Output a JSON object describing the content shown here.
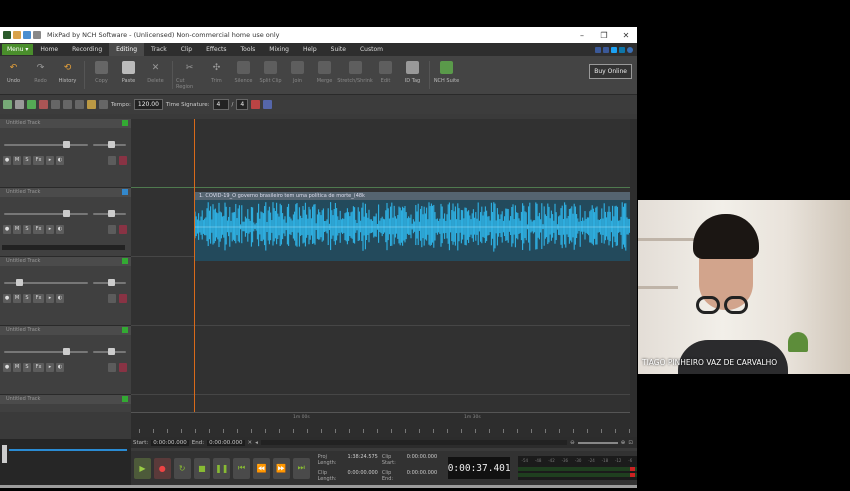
{
  "window": {
    "title": "MixPad by NCH Software - (Unlicensed) Non-commercial home use only",
    "controls": [
      "–",
      "❐",
      "✕"
    ]
  },
  "menubar": {
    "menu_label": "Menu ▾",
    "items": [
      "Home",
      "Recording",
      "Editing",
      "Track",
      "Clip",
      "Effects",
      "Tools",
      "Mixing",
      "Help",
      "Suite",
      "Custom"
    ],
    "active": "Editing"
  },
  "toolbar": {
    "buttons": [
      {
        "label": "Undo",
        "icon": "undo-icon"
      },
      {
        "label": "Redo",
        "icon": "redo-icon"
      },
      {
        "label": "History",
        "icon": "history-icon"
      },
      {
        "label": "Copy",
        "icon": "copy-icon"
      },
      {
        "label": "Paste",
        "icon": "paste-icon"
      },
      {
        "label": "Delete",
        "icon": "delete-icon"
      },
      {
        "label": "Cut Region",
        "icon": "cut-region-icon"
      },
      {
        "label": "Trim",
        "icon": "trim-icon"
      },
      {
        "label": "Silence",
        "icon": "silence-icon"
      },
      {
        "label": "Split Clip",
        "icon": "split-clip-icon"
      },
      {
        "label": "Join",
        "icon": "join-icon"
      },
      {
        "label": "Merge",
        "icon": "merge-icon"
      },
      {
        "label": "Stretch/Shrink",
        "icon": "stretch-icon"
      },
      {
        "label": "Edit",
        "icon": "edit-icon"
      },
      {
        "label": "ID Tag",
        "icon": "id-tag-icon"
      },
      {
        "label": "NCH Suite",
        "icon": "nch-suite-icon"
      }
    ],
    "buy_label": "Buy Online"
  },
  "tempobar": {
    "tempo_label": "Tempo:",
    "tempo_value": "120.00",
    "ts_label": "Time Signature:",
    "ts_num": "4",
    "ts_sep": "/",
    "ts_den": "4"
  },
  "tracks": [
    {
      "name": "Untitled Track"
    },
    {
      "name": "Untitled Track"
    },
    {
      "name": "Untitled Track"
    },
    {
      "name": "Untitled Track"
    },
    {
      "name": "Untitled Track"
    }
  ],
  "track_buttons": [
    "●",
    "M",
    "S",
    "Fx",
    "▸",
    "◐"
  ],
  "clip": {
    "title": "1. COVID-19_O governo brasileiro tem uma política de morte_(48k"
  },
  "ruler": {
    "labels": [
      "1m 00s",
      "1m 30s"
    ]
  },
  "range": {
    "start_label": "Start:",
    "start_value": "0:00:00.000",
    "end_label": "End:",
    "end_value": "0:00:00.000"
  },
  "transport": {
    "proj_length_label": "Proj Length:",
    "proj_length_value": "1:38:24.575",
    "clip_start_label": "Clip Start:",
    "clip_start_value": "0:00:00.000",
    "clip_length_label": "Clip Length:",
    "clip_length_value": "0:00:00.000",
    "clip_end_label": "Clip End:",
    "clip_end_value": "0:00:00.000",
    "time": "0:00:37.401",
    "meter_scale": [
      "-54",
      "-48",
      "-42",
      "-36",
      "-30",
      "-24",
      "-18",
      "-12",
      "-6",
      "0"
    ]
  },
  "webcam": {
    "name": "TIAGO PINHEIRO VAZ DE CARVALHO"
  },
  "colors": {
    "waveform": "#2fb3e6",
    "playhead": "#d86a1a",
    "menu_green": "#4a8e2c"
  }
}
